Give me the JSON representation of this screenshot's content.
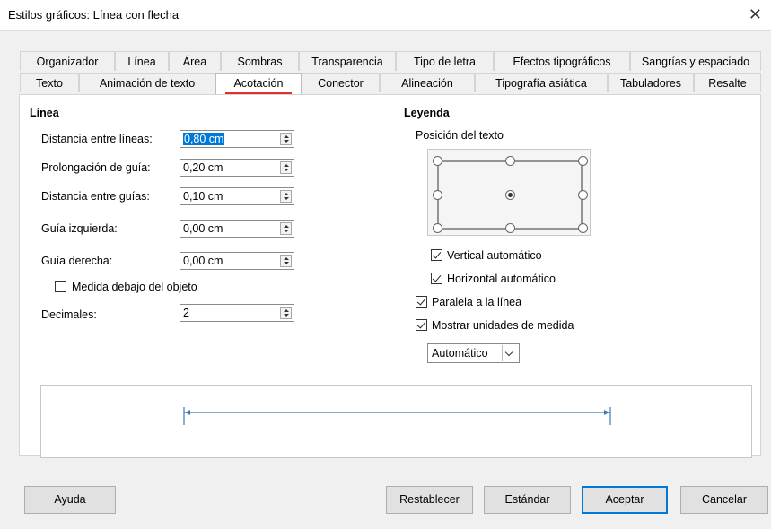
{
  "window": {
    "title": "Estilos gráficos: Línea con flecha"
  },
  "tabs_row1": [
    "Organizador",
    "Línea",
    "Área",
    "Sombras",
    "Transparencia",
    "Tipo de letra",
    "Efectos tipográficos",
    "Sangrías y espaciado"
  ],
  "tabs_row2": [
    "Texto",
    "Animación de texto",
    "Acotación",
    "Conector",
    "Alineación",
    "Tipografía asiática",
    "Tabuladores",
    "Resalte"
  ],
  "active_tab": "Acotación",
  "linea": {
    "header": "Línea",
    "fields": [
      {
        "label": "Distancia entre líneas:",
        "value": "0,80 cm"
      },
      {
        "label": "Prolongación de guía:",
        "value": "0,20 cm"
      },
      {
        "label": "Distancia entre guías:",
        "value": "0,10 cm"
      },
      {
        "label": "Guía izquierda:",
        "value": "0,00 cm"
      },
      {
        "label": "Guía derecha:",
        "value": "0,00 cm"
      }
    ],
    "below_object": {
      "label": "Medida debajo del objeto",
      "checked": false
    },
    "decimals": {
      "label": "Decimales:",
      "value": "2"
    }
  },
  "leyenda": {
    "header": "Leyenda",
    "position_label": "Posición del texto",
    "vertical_auto": {
      "label": "Vertical automático",
      "checked": true
    },
    "horizontal_auto": {
      "label": "Horizontal automático",
      "checked": true
    },
    "parallel": {
      "label": "Paralela a la línea",
      "checked": true
    },
    "show_units": {
      "label": "Mostrar unidades de medida",
      "checked": true
    },
    "units_select": "Automático"
  },
  "buttons": {
    "help": "Ayuda",
    "reset": "Restablecer",
    "standard": "Estándar",
    "ok": "Aceptar",
    "cancel": "Cancelar"
  },
  "colors": {
    "accent": "#0078d7",
    "tab_underline": "#e03030",
    "preview_line": "#3c7ab8"
  }
}
